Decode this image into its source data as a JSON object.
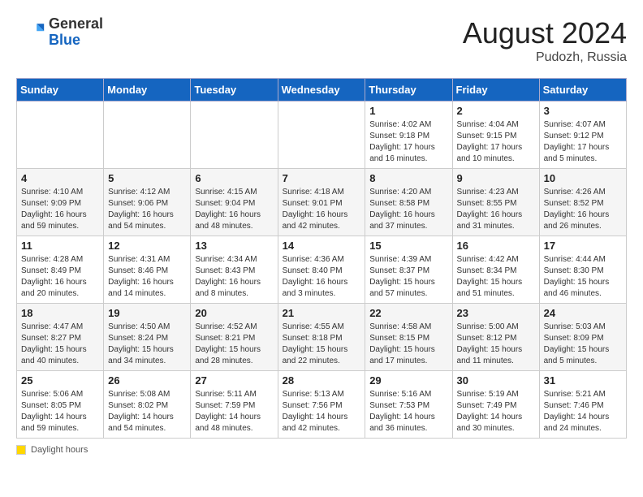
{
  "header": {
    "logo_general": "General",
    "logo_blue": "Blue",
    "month_year": "August 2024",
    "location": "Pudozh, Russia"
  },
  "footer": {
    "daylight_label": "Daylight hours"
  },
  "calendar": {
    "headers": [
      "Sunday",
      "Monday",
      "Tuesday",
      "Wednesday",
      "Thursday",
      "Friday",
      "Saturday"
    ],
    "weeks": [
      [
        {
          "day": "",
          "detail": ""
        },
        {
          "day": "",
          "detail": ""
        },
        {
          "day": "",
          "detail": ""
        },
        {
          "day": "",
          "detail": ""
        },
        {
          "day": "1",
          "detail": "Sunrise: 4:02 AM\nSunset: 9:18 PM\nDaylight: 17 hours\nand 16 minutes."
        },
        {
          "day": "2",
          "detail": "Sunrise: 4:04 AM\nSunset: 9:15 PM\nDaylight: 17 hours\nand 10 minutes."
        },
        {
          "day": "3",
          "detail": "Sunrise: 4:07 AM\nSunset: 9:12 PM\nDaylight: 17 hours\nand 5 minutes."
        }
      ],
      [
        {
          "day": "4",
          "detail": "Sunrise: 4:10 AM\nSunset: 9:09 PM\nDaylight: 16 hours\nand 59 minutes."
        },
        {
          "day": "5",
          "detail": "Sunrise: 4:12 AM\nSunset: 9:06 PM\nDaylight: 16 hours\nand 54 minutes."
        },
        {
          "day": "6",
          "detail": "Sunrise: 4:15 AM\nSunset: 9:04 PM\nDaylight: 16 hours\nand 48 minutes."
        },
        {
          "day": "7",
          "detail": "Sunrise: 4:18 AM\nSunset: 9:01 PM\nDaylight: 16 hours\nand 42 minutes."
        },
        {
          "day": "8",
          "detail": "Sunrise: 4:20 AM\nSunset: 8:58 PM\nDaylight: 16 hours\nand 37 minutes."
        },
        {
          "day": "9",
          "detail": "Sunrise: 4:23 AM\nSunset: 8:55 PM\nDaylight: 16 hours\nand 31 minutes."
        },
        {
          "day": "10",
          "detail": "Sunrise: 4:26 AM\nSunset: 8:52 PM\nDaylight: 16 hours\nand 26 minutes."
        }
      ],
      [
        {
          "day": "11",
          "detail": "Sunrise: 4:28 AM\nSunset: 8:49 PM\nDaylight: 16 hours\nand 20 minutes."
        },
        {
          "day": "12",
          "detail": "Sunrise: 4:31 AM\nSunset: 8:46 PM\nDaylight: 16 hours\nand 14 minutes."
        },
        {
          "day": "13",
          "detail": "Sunrise: 4:34 AM\nSunset: 8:43 PM\nDaylight: 16 hours\nand 8 minutes."
        },
        {
          "day": "14",
          "detail": "Sunrise: 4:36 AM\nSunset: 8:40 PM\nDaylight: 16 hours\nand 3 minutes."
        },
        {
          "day": "15",
          "detail": "Sunrise: 4:39 AM\nSunset: 8:37 PM\nDaylight: 15 hours\nand 57 minutes."
        },
        {
          "day": "16",
          "detail": "Sunrise: 4:42 AM\nSunset: 8:34 PM\nDaylight: 15 hours\nand 51 minutes."
        },
        {
          "day": "17",
          "detail": "Sunrise: 4:44 AM\nSunset: 8:30 PM\nDaylight: 15 hours\nand 46 minutes."
        }
      ],
      [
        {
          "day": "18",
          "detail": "Sunrise: 4:47 AM\nSunset: 8:27 PM\nDaylight: 15 hours\nand 40 minutes."
        },
        {
          "day": "19",
          "detail": "Sunrise: 4:50 AM\nSunset: 8:24 PM\nDaylight: 15 hours\nand 34 minutes."
        },
        {
          "day": "20",
          "detail": "Sunrise: 4:52 AM\nSunset: 8:21 PM\nDaylight: 15 hours\nand 28 minutes."
        },
        {
          "day": "21",
          "detail": "Sunrise: 4:55 AM\nSunset: 8:18 PM\nDaylight: 15 hours\nand 22 minutes."
        },
        {
          "day": "22",
          "detail": "Sunrise: 4:58 AM\nSunset: 8:15 PM\nDaylight: 15 hours\nand 17 minutes."
        },
        {
          "day": "23",
          "detail": "Sunrise: 5:00 AM\nSunset: 8:12 PM\nDaylight: 15 hours\nand 11 minutes."
        },
        {
          "day": "24",
          "detail": "Sunrise: 5:03 AM\nSunset: 8:09 PM\nDaylight: 15 hours\nand 5 minutes."
        }
      ],
      [
        {
          "day": "25",
          "detail": "Sunrise: 5:06 AM\nSunset: 8:05 PM\nDaylight: 14 hours\nand 59 minutes."
        },
        {
          "day": "26",
          "detail": "Sunrise: 5:08 AM\nSunset: 8:02 PM\nDaylight: 14 hours\nand 54 minutes."
        },
        {
          "day": "27",
          "detail": "Sunrise: 5:11 AM\nSunset: 7:59 PM\nDaylight: 14 hours\nand 48 minutes."
        },
        {
          "day": "28",
          "detail": "Sunrise: 5:13 AM\nSunset: 7:56 PM\nDaylight: 14 hours\nand 42 minutes."
        },
        {
          "day": "29",
          "detail": "Sunrise: 5:16 AM\nSunset: 7:53 PM\nDaylight: 14 hours\nand 36 minutes."
        },
        {
          "day": "30",
          "detail": "Sunrise: 5:19 AM\nSunset: 7:49 PM\nDaylight: 14 hours\nand 30 minutes."
        },
        {
          "day": "31",
          "detail": "Sunrise: 5:21 AM\nSunset: 7:46 PM\nDaylight: 14 hours\nand 24 minutes."
        }
      ]
    ]
  }
}
